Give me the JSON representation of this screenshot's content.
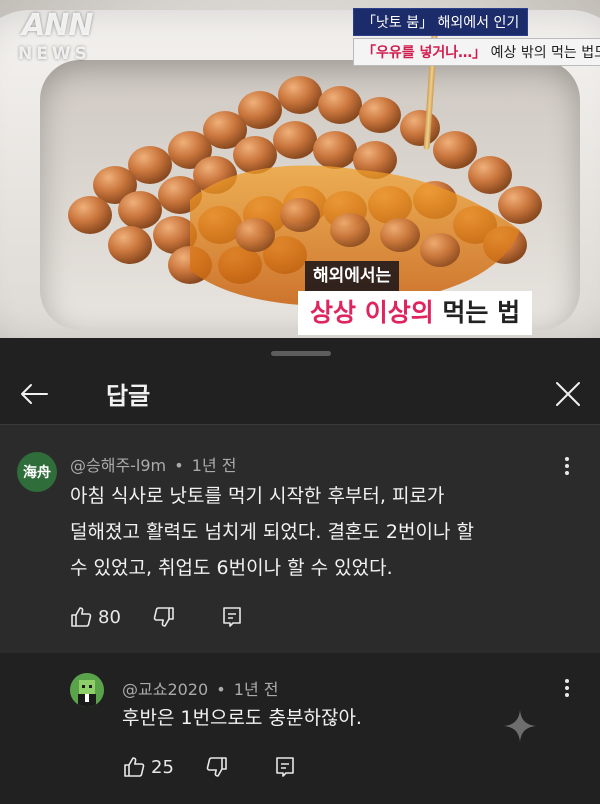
{
  "video": {
    "logo_top": "ANN",
    "logo_bottom": "NEWS",
    "ticker_line1": "「낫토 붐」 해외에서 인기",
    "ticker_line2_highlight": "「우유를 넣거나…」",
    "ticker_line2_rest": " 예상 밖의 먹는 법도",
    "caption_small": "해외에서는",
    "caption_big_highlight": "상상 이상의",
    "caption_big_rest": " 먹는 법"
  },
  "header": {
    "title": "답글",
    "back_icon": "arrow-left-icon",
    "close_icon": "close-icon"
  },
  "comment": {
    "avatar_text": "海舟",
    "author": "@승해주-l9m",
    "separator": "•",
    "time": "1년 전",
    "lines": [
      "아침 식사로 낫토를 먹기 시작한 후부터, 피로가",
      "덜해졌고 활력도 넘치게 되었다. 결혼도 2번이나 할",
      "수 있었고, 취업도 6번이나 할 수 있었다."
    ],
    "likes": "80"
  },
  "reply": {
    "author": "@교쇼2020",
    "separator": "•",
    "time": "1년 전",
    "text": "후반은 1번으로도 충분하잖아.",
    "likes": "25"
  },
  "colors": {
    "background": "#212121",
    "highlighted_comment": "#2b2b2b",
    "caption_pink": "#e0245e"
  }
}
